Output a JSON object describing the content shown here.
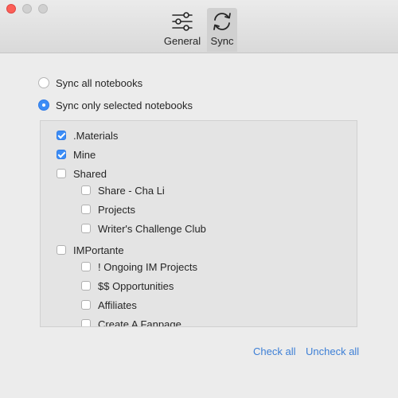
{
  "toolbar": {
    "tabs": [
      {
        "label": "General",
        "icon": "sliders-icon"
      },
      {
        "label": "Sync",
        "icon": "sync-icon",
        "selected": true
      }
    ]
  },
  "sync_options": {
    "all": {
      "label": "Sync all notebooks",
      "selected": false
    },
    "selected": {
      "label": "Sync only selected notebooks",
      "selected": true
    }
  },
  "notebooks": [
    {
      "label": ".Materials",
      "checked": true,
      "level": 0
    },
    {
      "label": "Mine",
      "checked": true,
      "level": 0
    },
    {
      "label": "Shared",
      "checked": false,
      "level": 0
    },
    {
      "label": "Share - Cha Li",
      "checked": false,
      "level": 1
    },
    {
      "label": "Projects",
      "checked": false,
      "level": 1
    },
    {
      "label": "Writer's Challenge Club",
      "checked": false,
      "level": 1
    },
    {
      "label": "IMPortante",
      "checked": false,
      "level": 0
    },
    {
      "label": "! Ongoing IM Projects",
      "checked": false,
      "level": 1
    },
    {
      "label": "$$ Opportunities",
      "checked": false,
      "level": 1
    },
    {
      "label": "Affiliates",
      "checked": false,
      "level": 1
    },
    {
      "label": "Create A Fanpage",
      "checked": false,
      "level": 1
    }
  ],
  "actions": {
    "check_all": "Check all",
    "uncheck_all": "Uncheck all"
  },
  "colors": {
    "accent": "#3c8df6",
    "link": "#3d7fd6"
  }
}
